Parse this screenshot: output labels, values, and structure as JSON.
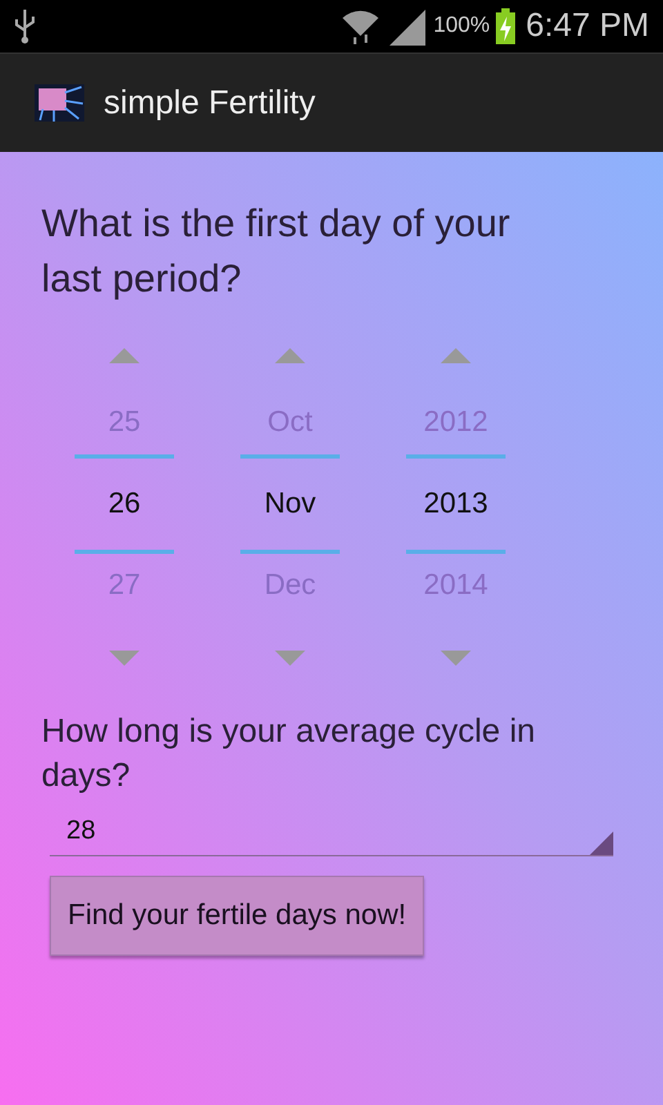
{
  "status_bar": {
    "battery": "100%",
    "time": "6:47 PM"
  },
  "app_bar": {
    "title": "simple Fertility"
  },
  "question": "What is the first day of your last period?",
  "pickers": [
    {
      "previous": "25",
      "current": "26",
      "next": "27"
    },
    {
      "previous": "Oct",
      "current": "Nov",
      "next": "Dec"
    },
    {
      "previous": "2012",
      "current": "2013",
      "next": "2014"
    }
  ],
  "cycle_question": "How long is your average cycle in days?",
  "cycle_field": {
    "value": "28"
  },
  "button": "Find your fertile days now!"
}
